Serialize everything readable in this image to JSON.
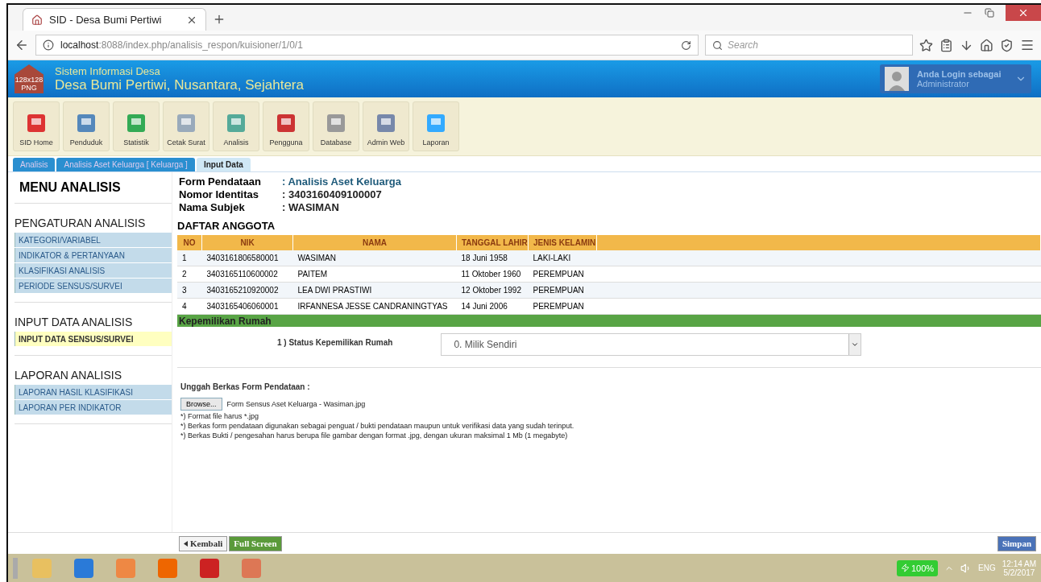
{
  "browser": {
    "tab_title": "SID - Desa Bumi Pertiwi",
    "url_host": "localhost",
    "url_rest": ":8088/index.php/analisis_respon/kuisioner/1/0/1",
    "search_placeholder": "Search"
  },
  "header": {
    "logo_lines": [
      "128x128",
      "PNG"
    ],
    "subtitle": "Sistem Informasi Desa",
    "title": "Desa Bumi Pertiwi, Nusantara, Sejahtera",
    "user_line1": "Anda Login sebagai",
    "user_line2": "Administrator"
  },
  "toolbar": [
    "SID Home",
    "Penduduk",
    "Statistik",
    "Cetak Surat",
    "Analisis",
    "Pengguna",
    "Database",
    "Admin Web",
    "Laporan"
  ],
  "crumbs": [
    {
      "label": "Analisis",
      "selected": false
    },
    {
      "label": "Analisis Aset Keluarga [ Keluarga ]",
      "selected": false
    },
    {
      "label": "Input Data",
      "selected": true
    }
  ],
  "sidebar": {
    "title": "MENU ANALISIS",
    "sections": [
      {
        "heading": "PENGATURAN ANALISIS",
        "items": [
          {
            "label": "KATEGORI/VARIABEL",
            "selected": false
          },
          {
            "label": "INDIKATOR & PERTANYAAN",
            "selected": false
          },
          {
            "label": "KLASIFIKASI ANALISIS",
            "selected": false
          },
          {
            "label": "PERIODE SENSUS/SURVEI",
            "selected": false
          }
        ]
      },
      {
        "heading": "INPUT DATA ANALISIS",
        "items": [
          {
            "label": "INPUT DATA SENSUS/SURVEI",
            "selected": true
          }
        ]
      },
      {
        "heading": "LAPORAN ANALISIS",
        "items": [
          {
            "label": "LAPORAN HASIL KLASIFIKASI",
            "selected": false
          },
          {
            "label": "LAPORAN PER INDIKATOR",
            "selected": false
          }
        ]
      }
    ]
  },
  "info": [
    {
      "label": "Form Pendataan",
      "value": ": Analisis Aset Keluarga",
      "kind": "link"
    },
    {
      "label": "Nomor Identitas",
      "value": ": 3403160409100007",
      "kind": "plain"
    },
    {
      "label": "Nama Subjek",
      "value": ": WASIMAN",
      "kind": "plain"
    }
  ],
  "members": {
    "title": "DAFTAR ANGGOTA",
    "columns": [
      "NO",
      "NIK",
      "NAMA",
      "TANGGAL LAHIR",
      "JENIS KELAMIN"
    ],
    "rows": [
      [
        "1",
        "3403161806580001",
        "WASIMAN",
        "18 Juni 1958",
        "LAKI-LAKI"
      ],
      [
        "2",
        "3403165110600002",
        "PAITEM",
        "11 Oktober 1960",
        "PEREMPUAN"
      ],
      [
        "3",
        "3403165210920002",
        "LEA DWI PRASTIWI",
        "12 Oktober 1992",
        "PEREMPUAN"
      ],
      [
        "4",
        "3403165406060001",
        "IRFANNESA JESSE CANDRANINGTYAS",
        "14 Juni 2006",
        "PEREMPUAN"
      ]
    ]
  },
  "section": "Kepemilikan Rumah",
  "question": {
    "label": "1 ) Status Kepemilikan Rumah",
    "value": "0. Milik Sendiri"
  },
  "upload": {
    "heading": "Unggah Berkas Form Pendataan :",
    "button": "Browse...",
    "filename": "Form Sensus Aset Keluarga - Wasiman.jpg",
    "notes": [
      "*) Format file harus *.jpg",
      "*) Berkas form pendataan digunakan sebagai penguat / bukti pendataan maupun untuk verifikasi data yang sudah terinput.",
      "*) Berkas Bukti / pengesahan harus berupa file gambar dengan format .jpg, dengan ukuran maksimal 1 Mb (1 megabyte)"
    ]
  },
  "footer": {
    "back": "Kembali",
    "fullscreen": "Full Screen",
    "save": "Simpan"
  },
  "taskbar": {
    "battery": "100%",
    "lang": "ENG",
    "time": "12:14 AM",
    "date": "5/2/2017"
  }
}
